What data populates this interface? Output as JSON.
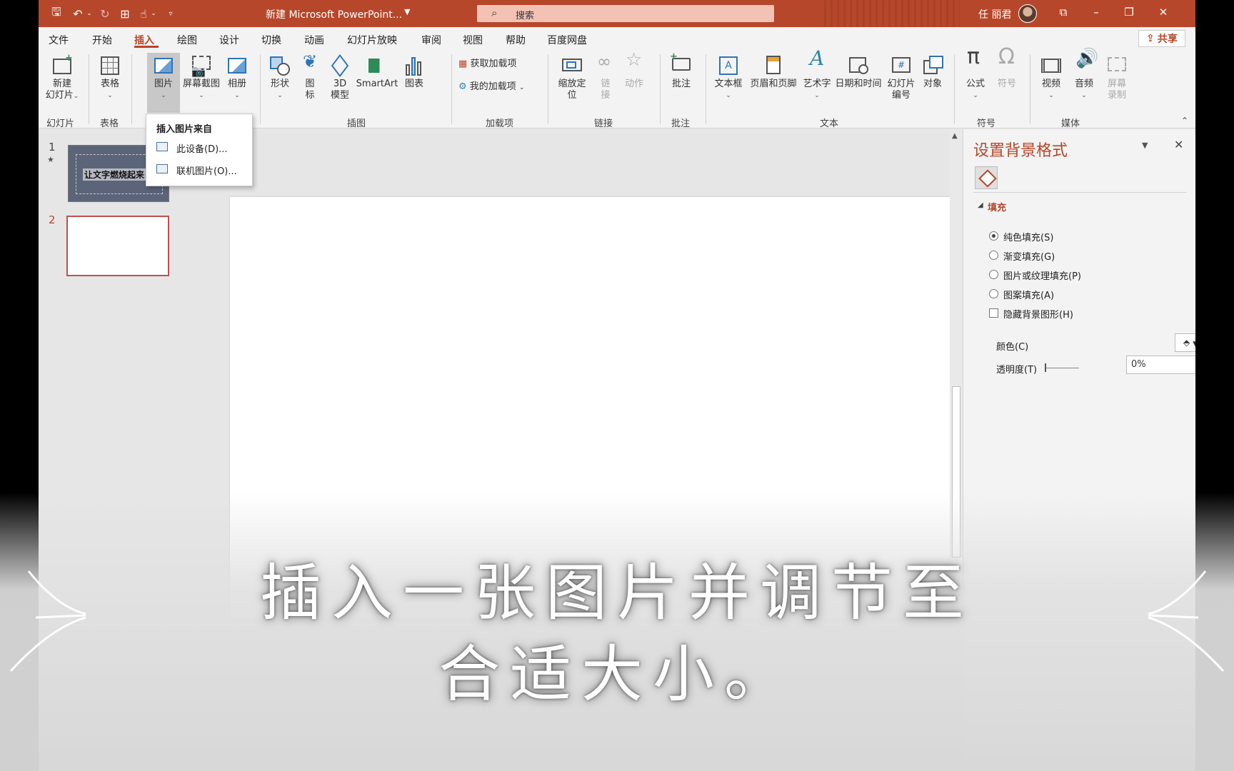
{
  "titlebar": {
    "doc_title": "新建 Microsoft PowerPoint...",
    "search_placeholder": "搜索",
    "user_name": "任 丽君"
  },
  "menu": {
    "tabs": [
      "文件",
      "开始",
      "插入",
      "绘图",
      "设计",
      "切换",
      "动画",
      "幻灯片放映",
      "审阅",
      "视图",
      "帮助",
      "百度网盘"
    ],
    "active_tab": "插入",
    "share_label": "共享"
  },
  "ribbon": {
    "new_slide": "新建\n幻灯片",
    "table": "表格",
    "picture": "图片",
    "screenshot": "屏幕截图",
    "album": "相册",
    "shapes": "形状",
    "icons": "图\n标",
    "model3d": "3D\n模型",
    "smartart": "SmartArt",
    "chart": "图表",
    "get_addins": "获取加载项",
    "my_addins": "我的加载项",
    "zoom": "缩放定\n位",
    "link": "链\n接",
    "action": "动作",
    "comment": "批注",
    "textbox": "文本框",
    "header_footer": "页眉和页脚",
    "wordart": "艺术字",
    "datetime": "日期和时间",
    "slide_number": "幻灯片\n编号",
    "object": "对象",
    "equation": "公式",
    "symbol": "符号",
    "video": "视频",
    "audio": "音频",
    "screen_record": "屏幕\n录制",
    "groups": {
      "slides": "幻灯片",
      "tables": "表格",
      "illustrations": "插图",
      "addins": "加载项",
      "links": "链接",
      "comments": "批注",
      "text": "文本",
      "symbols": "符号",
      "media": "媒体"
    }
  },
  "picture_dropdown": {
    "header": "插入图片来自",
    "items": [
      "此设备(D)...",
      "联机图片(O)..."
    ]
  },
  "slides": {
    "slide1_number": "1",
    "slide1_text": "让文字燃烧起来",
    "slide2_number": "2"
  },
  "format_pane": {
    "title": "设置背景格式",
    "section": "填充",
    "options": [
      "纯色填充(S)",
      "渐变填充(G)",
      "图片或纹理填充(P)",
      "图案填充(A)"
    ],
    "selected_option": "纯色填充(S)",
    "hide_bg_graphics": "隐藏背景图形(H)",
    "color_label": "颜色(C)",
    "transparency_label": "透明度(T)",
    "transparency_value": "0%"
  },
  "caption": {
    "line1": "插入一张图片并调节至",
    "line2": "合适大小。"
  }
}
